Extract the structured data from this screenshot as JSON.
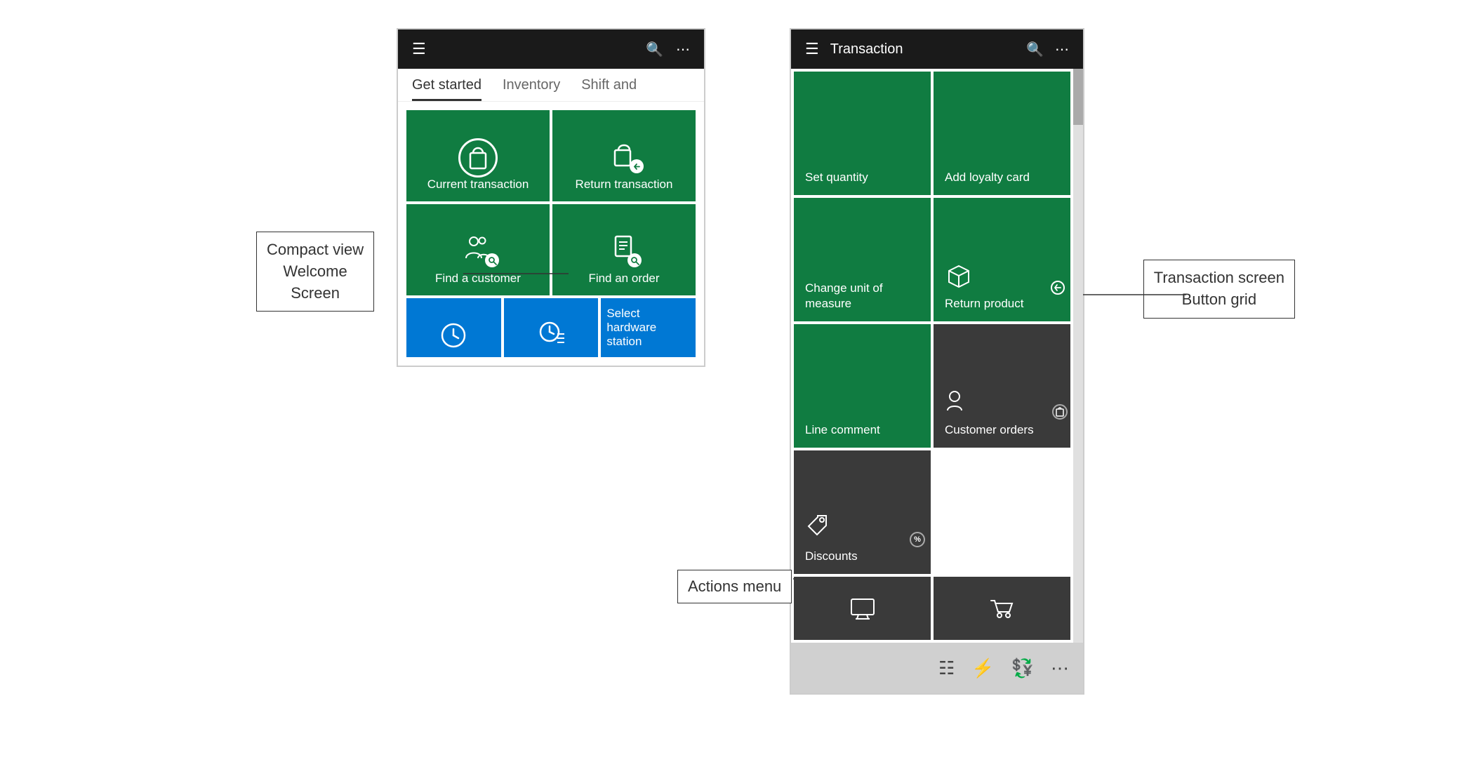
{
  "page": {
    "background": "#ffffff"
  },
  "left_panel": {
    "label": "Compact view\nWelcome\nScreen",
    "topbar": {
      "hamburger": "≡",
      "search": "🔍",
      "dots": "···"
    },
    "tabs": [
      {
        "label": "Get started",
        "active": true
      },
      {
        "label": "Inventory",
        "active": false
      },
      {
        "label": "Shift and",
        "active": false
      }
    ],
    "tiles": [
      {
        "id": "current-transaction",
        "label": "Current transaction",
        "color": "green",
        "icon": "bag"
      },
      {
        "id": "return-transaction",
        "label": "Return transaction",
        "color": "green",
        "icon": "return-bag"
      },
      {
        "id": "find-customer",
        "label": "Find a customer",
        "color": "green",
        "icon": "people-search"
      },
      {
        "id": "find-order",
        "label": "Find an order",
        "color": "green",
        "icon": "order-search"
      }
    ],
    "bottom_tiles": [
      {
        "id": "clock1",
        "label": "",
        "color": "blue",
        "icon": "clock"
      },
      {
        "id": "clock2",
        "label": "",
        "color": "blue",
        "icon": "clock-list"
      },
      {
        "id": "hardware",
        "label": "Select hardware station",
        "color": "blue",
        "icon": ""
      }
    ]
  },
  "right_panel": {
    "label_grid": "Transaction screen\nButton grid",
    "label_actions": "Actions menu",
    "topbar": {
      "hamburger": "≡",
      "title": "Transaction",
      "search": "🔍",
      "dots": "···"
    },
    "tiles": [
      {
        "id": "set-quantity",
        "label": "Set quantity",
        "color": "green",
        "icon": ""
      },
      {
        "id": "add-loyalty",
        "label": "Add loyalty card",
        "color": "green",
        "icon": ""
      },
      {
        "id": "change-uom",
        "label": "Change unit of\nmeasure",
        "color": "green",
        "icon": ""
      },
      {
        "id": "return-product",
        "label": "Return product",
        "color": "green",
        "icon": "return-product"
      },
      {
        "id": "line-comment",
        "label": "Line comment",
        "color": "green",
        "icon": ""
      },
      {
        "id": "customer-orders",
        "label": "Customer orders",
        "color": "dark",
        "icon": "customer-orders"
      },
      {
        "id": "discounts",
        "label": "Discounts",
        "color": "dark",
        "icon": "discounts"
      }
    ],
    "bottom_partial_tiles": [
      {
        "id": "tile-bottom-1",
        "label": "",
        "color": "dark",
        "icon": "monitor"
      },
      {
        "id": "tile-bottom-2",
        "label": "",
        "color": "dark",
        "icon": "cart"
      }
    ],
    "toolbar": {
      "icons": [
        "calculator",
        "lightning",
        "money",
        "dots"
      ]
    }
  }
}
